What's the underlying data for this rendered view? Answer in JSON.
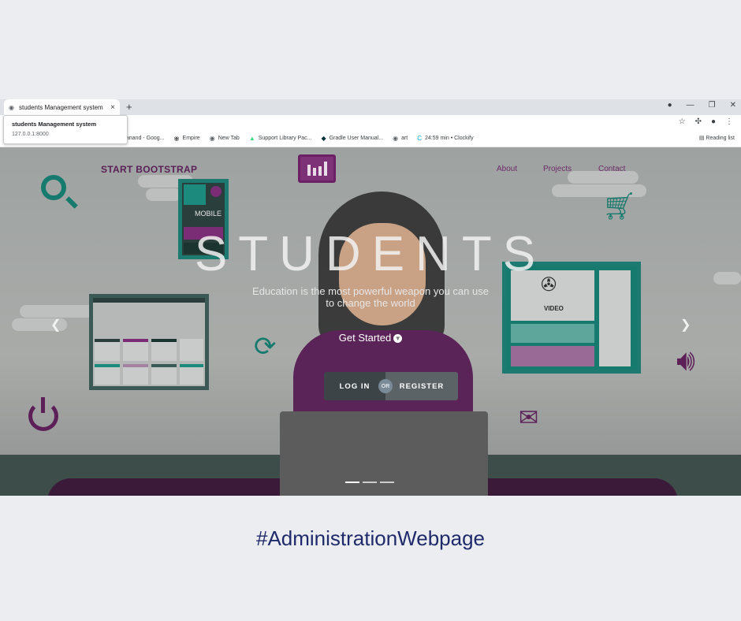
{
  "browser": {
    "tab_title": "students Management system",
    "tooltip": {
      "title": "students Management system",
      "url": "127.0.0.1:8000"
    },
    "bookmarks": [
      {
        "label": "iya anand - Goog...",
        "icon": "globe-icon"
      },
      {
        "label": "Empire",
        "icon": "globe-icon"
      },
      {
        "label": "New Tab",
        "icon": "globe-icon"
      },
      {
        "label": "Support Library Pac...",
        "icon": "android-icon"
      },
      {
        "label": "Gradle User Manual...",
        "icon": "gradle-icon"
      },
      {
        "label": "art",
        "icon": "globe-icon"
      },
      {
        "label": "24:59 min • Clockify",
        "icon": "clockify-icon"
      }
    ],
    "reading_list": "Reading list"
  },
  "site": {
    "brand": "START BOOTSTRAP",
    "nav": [
      "About",
      "Projects",
      "Contact"
    ],
    "headline": "STUDENTS",
    "subline": "Education is the most powerful weapon you can use to change the world",
    "cta": "Get Started",
    "login": "LOG IN",
    "or": "OR",
    "register": "REGISTER",
    "illustration_labels": {
      "mobile": "MOBILE",
      "video": "VIDEO"
    }
  },
  "caption": "#AdministrationWebpage",
  "colors": {
    "accent_purple": "#6b2066",
    "accent_teal": "#177a6e",
    "caption": "#1f2a6b"
  }
}
